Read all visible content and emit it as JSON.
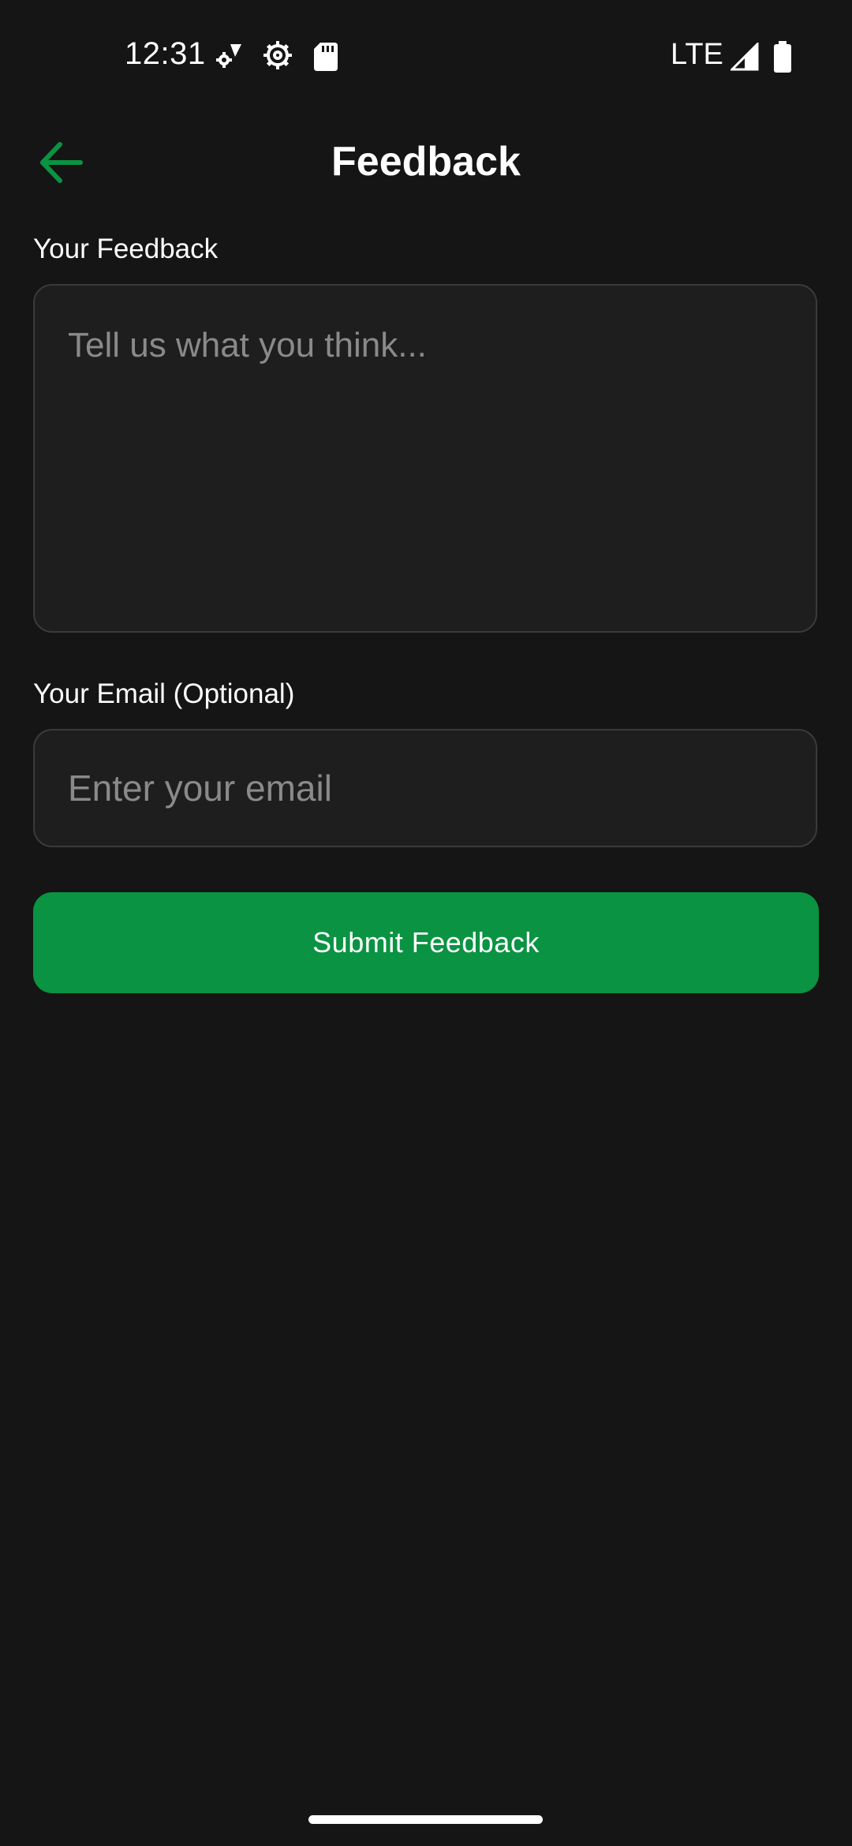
{
  "status_bar": {
    "time": "12:31",
    "network": "LTE",
    "icons": [
      "settings-sync-icon",
      "gear-icon",
      "sd-card-icon",
      "signal-icon",
      "battery-icon"
    ]
  },
  "header": {
    "title": "Feedback",
    "back_icon": "arrow-left-icon"
  },
  "form": {
    "feedback_label": "Your Feedback",
    "feedback_placeholder": "Tell us what you think...",
    "feedback_value": "",
    "email_label": "Your Email (Optional)",
    "email_placeholder": "Enter your email",
    "email_value": "",
    "submit_label": "Submit Feedback"
  },
  "colors": {
    "background": "#151515",
    "accent": "#0a9342",
    "field_background": "#1e1e1e",
    "field_border": "#3a3a3a",
    "placeholder": "#8a8a8a"
  }
}
